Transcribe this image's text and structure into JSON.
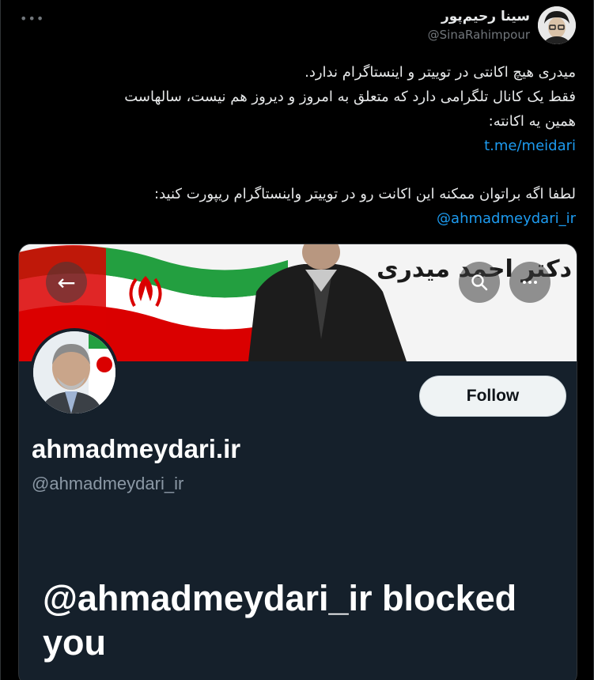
{
  "tweet": {
    "more_label": "•••",
    "author": {
      "display_name": "سینا رحیم‌پور",
      "handle": "@SinaRahimpour"
    },
    "body": {
      "line1": "میدری هیچ اکانتی در توییتر و اینستاگرام ندارد.",
      "line2": "فقط یک کانال تلگرامی دارد که متعلق به امروز و دیروز هم نیست، سالهاست",
      "line3": "همین یه اکانته:",
      "link1": "t.me/meidari",
      "line4": "لطفا اگه براتوان ممکنه این اکانت رو در توییتر واینستاگرام ریپورت کنید:",
      "mention": "@ahmadmeydari_ir"
    }
  },
  "media": {
    "banner_title": "دکتر احمد میدری",
    "back_icon": "←",
    "follow_label": "Follow",
    "profile_name": "ahmadmeydari.ir",
    "profile_handle": "@ahmadmeydari_ir",
    "blocked_message": "@ahmadmeydari_ir blocked you"
  },
  "colors": {
    "background": "#000000",
    "link": "#1d9bf0",
    "profile_bg": "#15202b",
    "flag_green": "#239f40",
    "flag_red": "#da0000"
  }
}
